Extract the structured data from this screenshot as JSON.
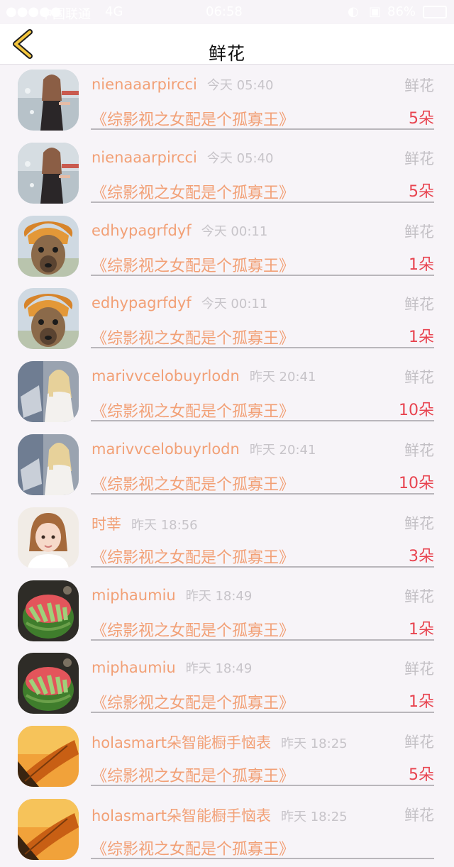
{
  "status_bar": {
    "carrier": "中国联通",
    "network": "4G",
    "time": "06:58",
    "battery": "86%"
  },
  "navbar": {
    "back_icon": "chevron-left-icon",
    "title": "鲜花"
  },
  "records": [
    {
      "name": "nienaaarpircci",
      "time": "今天 05:40",
      "gift_type": "鲜花",
      "book": "《综影视之女配是个孤寡王》",
      "qty": "5朵",
      "avatar": "woman-dark-dress"
    },
    {
      "name": "nienaaarpircci",
      "time": "今天 05:40",
      "gift_type": "鲜花",
      "book": "《综影视之女配是个孤寡王》",
      "qty": "5朵",
      "avatar": "woman-dark-dress"
    },
    {
      "name": "edhypagrfdyf",
      "time": "今天 00:11",
      "gift_type": "鲜花",
      "book": "《综影视之女配是个孤寡王》",
      "qty": "1朵",
      "avatar": "alpaca"
    },
    {
      "name": "edhypagrfdyf",
      "time": "今天 00:11",
      "gift_type": "鲜花",
      "book": "《综影视之女配是个孤寡王》",
      "qty": "1朵",
      "avatar": "alpaca"
    },
    {
      "name": "marivvcelobuyrlodn",
      "time": "昨天 20:41",
      "gift_type": "鲜花",
      "book": "《综影视之女配是个孤寡王》",
      "qty": "10朵",
      "avatar": "woman-blonde"
    },
    {
      "name": "marivvcelobuyrlodn",
      "time": "昨天 20:41",
      "gift_type": "鲜花",
      "book": "《综影视之女配是个孤寡王》",
      "qty": "10朵",
      "avatar": "woman-blonde"
    },
    {
      "name": "时莘",
      "time": "昨天 18:56",
      "gift_type": "鲜花",
      "book": "《综影视之女配是个孤寡王》",
      "qty": "3朵",
      "avatar": "woman-bob"
    },
    {
      "name": "miphaumiu",
      "time": "昨天 18:49",
      "gift_type": "鲜花",
      "book": "《综影视之女配是个孤寡王》",
      "qty": "1朵",
      "avatar": "watermelon"
    },
    {
      "name": "miphaumiu",
      "time": "昨天 18:49",
      "gift_type": "鲜花",
      "book": "《综影视之女配是个孤寡王》",
      "qty": "1朵",
      "avatar": "watermelon"
    },
    {
      "name": "holasmart朵智能橱手恼表",
      "time": "昨天 18:25",
      "gift_type": "鲜花",
      "book": "《综影视之女配是个孤寡王》",
      "qty": "5朵",
      "avatar": "autumn-leaf"
    },
    {
      "name": "holasmart朵智能橱手恼表",
      "time": "昨天 18:25",
      "gift_type": "鲜花",
      "book": "《综影视之女配是个孤寡王》",
      "qty": "",
      "avatar": "autumn-leaf"
    }
  ]
}
